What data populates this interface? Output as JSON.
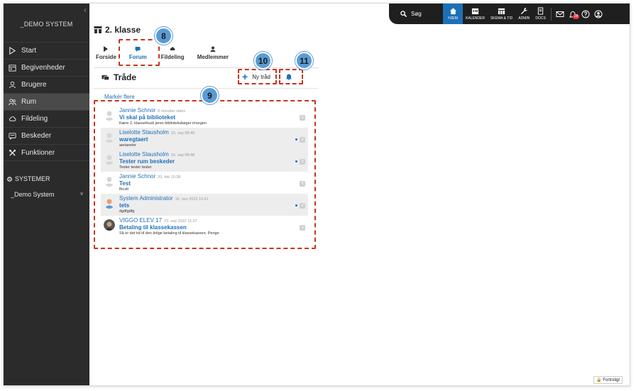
{
  "sidebar": {
    "brand": "_DEMO SYSTEM",
    "items": [
      {
        "label": "Start",
        "icon": "play-icon"
      },
      {
        "label": "Begivenheder",
        "icon": "calendar-icon"
      },
      {
        "label": "Brugere",
        "icon": "user-icon"
      },
      {
        "label": "Rum",
        "icon": "room-icon"
      },
      {
        "label": "Fildeling",
        "icon": "share-icon"
      },
      {
        "label": "Beskeder",
        "icon": "chat-icon"
      },
      {
        "label": "Funktioner",
        "icon": "tools-icon"
      }
    ],
    "section": "SYSTEMER",
    "sub_item": "_Demo System"
  },
  "topbar": {
    "search": "Søg",
    "home": "HJEM",
    "calendar": "KALENDER",
    "schedule": "SKEMA & TID",
    "admin": "ADMIN",
    "docs": "DOCS",
    "notification_count": "28"
  },
  "page": {
    "title": "2. klasse",
    "tabs": [
      "Forside",
      "Forum",
      "Fildeling",
      "Medlemmer"
    ],
    "section_title": "Tråde",
    "new_thread": "Ny tråd",
    "mark_more": "Markér flere",
    "footer": "Fortroligt"
  },
  "threads": [
    {
      "author": "Jannie Schnor",
      "time": "8 minutter siden",
      "title": "Vi skal på biblioteket",
      "preview": "Kære 2. klasseHusk jeres biblioteksbøger imorgen",
      "count": "0",
      "alt": false,
      "dot": false
    },
    {
      "author": "Liselotte Stausholm",
      "time": "15. sep 08:49",
      "title": "waregtaert",
      "preview": "aertareter",
      "count": "0",
      "alt": true,
      "dot": true
    },
    {
      "author": "Liselotte Stausholm",
      "time": "15. sep 08:48",
      "title": "Tester rum beskeder",
      "preview": "Tester tester tester",
      "count": "0",
      "alt": true,
      "dot": true
    },
    {
      "author": "Jannie Schnor",
      "time": "20. feb 15:38",
      "title": "Test",
      "preview": "fbcvb",
      "count": "0",
      "alt": false,
      "dot": false
    },
    {
      "author": "System Administrator",
      "time": "16. nov 2022 10:41",
      "title": "tets",
      "preview": "dgdfgdfg",
      "count": "0",
      "alt": true,
      "dot": true
    },
    {
      "author": "VIGGO ELEV 17",
      "time": "23. sep 2022 11:27",
      "title": "Betaling til klassekassen",
      "preview": "Så er det tid til den årlige betaling til klassekassen. Penge",
      "count": "3",
      "alt": false,
      "dot": false
    }
  ],
  "annotations": {
    "m8": "8",
    "m9": "9",
    "m10": "10",
    "m11": "11"
  },
  "colors": {
    "accent": "#1d6fb8",
    "sidebar": "#2b2b2b",
    "annotation": "#c8321e",
    "marker": "#5b9bd5"
  }
}
